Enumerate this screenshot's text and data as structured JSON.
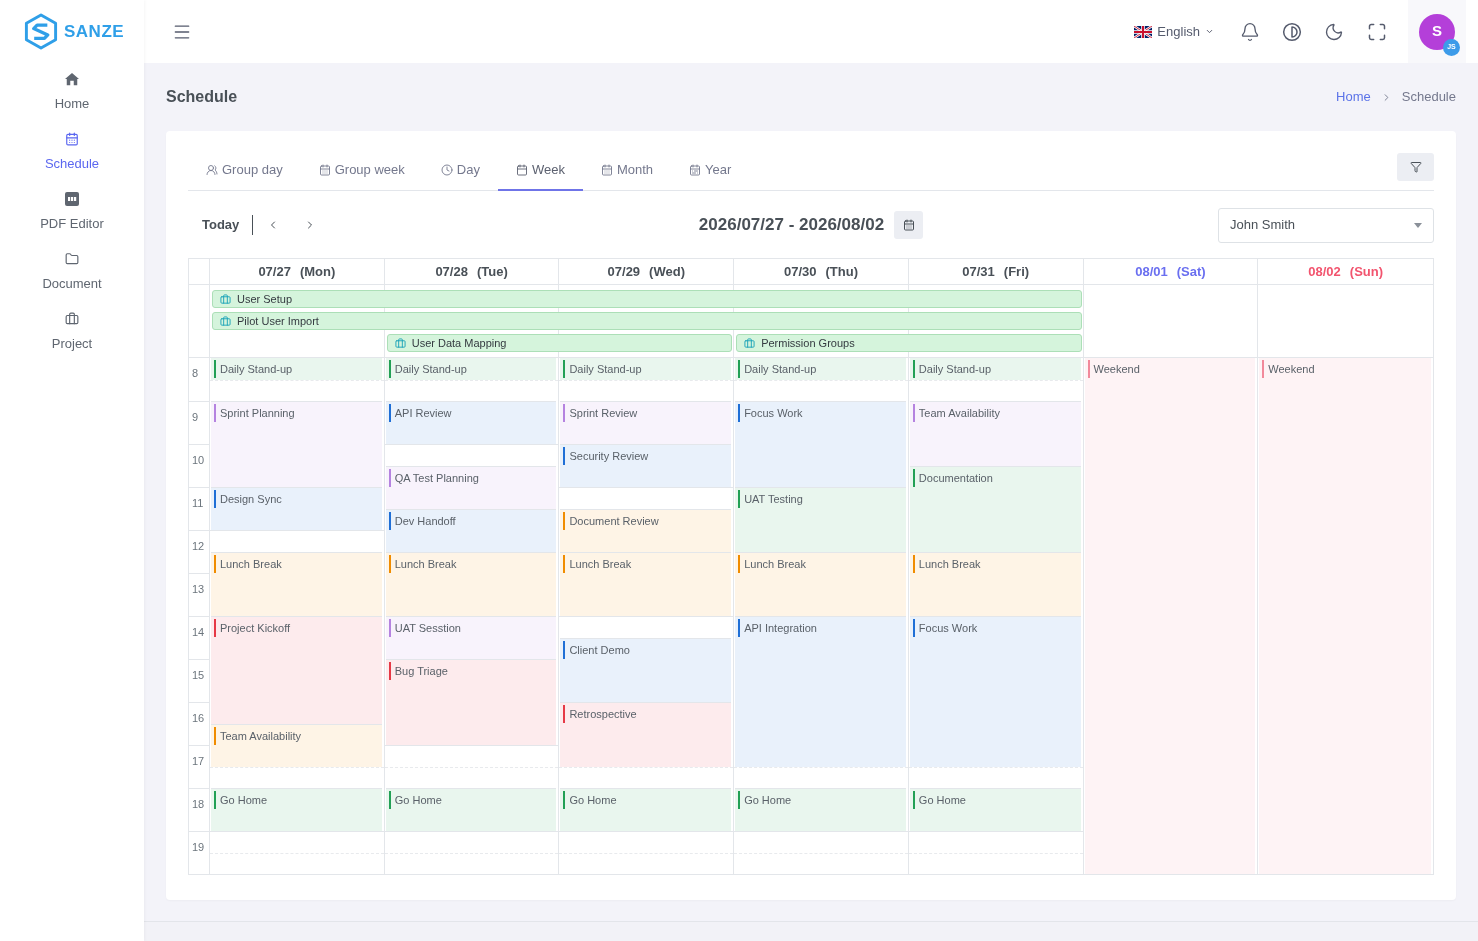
{
  "sidebar": {
    "logo_text": "SANZE",
    "items": [
      {
        "label": "Home",
        "selected": false
      },
      {
        "label": "Schedule",
        "selected": true
      },
      {
        "label": "PDF Editor",
        "selected": false
      },
      {
        "label": "Document",
        "selected": false
      },
      {
        "label": "Project",
        "selected": false
      }
    ]
  },
  "header": {
    "language": "English",
    "avatar": {
      "initial": "S",
      "badge": "JS"
    }
  },
  "page": {
    "title": "Schedule",
    "breadcrumb": [
      {
        "label": "Home",
        "kind": "link"
      },
      {
        "label": "Schedule",
        "kind": "current"
      }
    ]
  },
  "tabs": [
    {
      "label": "Group day",
      "selected": false
    },
    {
      "label": "Group week",
      "selected": false
    },
    {
      "label": "Day",
      "selected": false
    },
    {
      "label": "Week",
      "selected": true
    },
    {
      "label": "Month",
      "selected": false
    },
    {
      "label": "Year",
      "selected": false
    }
  ],
  "toolbar": {
    "today": "Today",
    "range": "2026/07/27 - 2026/08/02",
    "person": "John Smith"
  },
  "calendar": {
    "days": [
      {
        "date": "07/27",
        "weekday": "(Mon)",
        "kind": "weekday",
        "slots": [
          {
            "kind": "event",
            "title": "Daily Stand-up",
            "color": "#22a055"
          },
          {
            "kind": "free"
          },
          {
            "kind": "event",
            "title": "Sprint Planning",
            "color": "#b583e0"
          },
          {
            "kind": "continued"
          },
          {
            "kind": "continued"
          },
          {
            "kind": "continued"
          },
          {
            "kind": "event",
            "title": "Design Sync",
            "color": "#1f6fd6"
          },
          {
            "kind": "continued"
          },
          {
            "kind": "free"
          },
          {
            "kind": "event",
            "title": "Lunch Break",
            "color": "#f08c00"
          },
          {
            "kind": "continued"
          },
          {
            "kind": "continued"
          },
          {
            "kind": "event",
            "title": "Project Kickoff",
            "color": "#e63946"
          },
          {
            "kind": "continued"
          },
          {
            "kind": "continued"
          },
          {
            "kind": "continued"
          },
          {
            "kind": "continued"
          },
          {
            "kind": "event",
            "title": "Team Availability",
            "color": "#f08c00"
          },
          {
            "kind": "continued"
          },
          {
            "kind": "free"
          },
          {
            "kind": "event",
            "title": "Go Home",
            "color": "#22a055"
          },
          {
            "kind": "continued"
          },
          {
            "kind": "free"
          },
          {
            "kind": "free"
          }
        ]
      },
      {
        "date": "07/28",
        "weekday": "(Tue)",
        "kind": "weekday",
        "slots": [
          {
            "kind": "event",
            "title": "Daily Stand-up",
            "color": "#22a055"
          },
          {
            "kind": "free"
          },
          {
            "kind": "event",
            "title": "API Review",
            "color": "#1f6fd6"
          },
          {
            "kind": "continued"
          },
          {
            "kind": "free"
          },
          {
            "kind": "event",
            "title": "QA Test Planning",
            "color": "#b583e0"
          },
          {
            "kind": "continued"
          },
          {
            "kind": "event",
            "title": "Dev Handoff",
            "color": "#1f6fd6"
          },
          {
            "kind": "continued"
          },
          {
            "kind": "event",
            "title": "Lunch Break",
            "color": "#f08c00"
          },
          {
            "kind": "continued"
          },
          {
            "kind": "continued"
          },
          {
            "kind": "event",
            "title": "UAT Sesstion",
            "color": "#b583e0"
          },
          {
            "kind": "continued"
          },
          {
            "kind": "event",
            "title": "Bug Triage",
            "color": "#e63946"
          },
          {
            "kind": "continued"
          },
          {
            "kind": "continued"
          },
          {
            "kind": "continued"
          },
          {
            "kind": "free"
          },
          {
            "kind": "free"
          },
          {
            "kind": "event",
            "title": "Go Home",
            "color": "#22a055"
          },
          {
            "kind": "continued"
          },
          {
            "kind": "free"
          },
          {
            "kind": "free"
          }
        ]
      },
      {
        "date": "07/29",
        "weekday": "(Wed)",
        "kind": "weekday",
        "slots": [
          {
            "kind": "event",
            "title": "Daily Stand-up",
            "color": "#22a055"
          },
          {
            "kind": "free"
          },
          {
            "kind": "event",
            "title": "Sprint Review",
            "color": "#b583e0"
          },
          {
            "kind": "continued"
          },
          {
            "kind": "event",
            "title": "Security Review",
            "color": "#1f6fd6"
          },
          {
            "kind": "continued"
          },
          {
            "kind": "free"
          },
          {
            "kind": "event",
            "title": "Document Review",
            "color": "#f08c00"
          },
          {
            "kind": "continued"
          },
          {
            "kind": "event",
            "title": "Lunch Break",
            "color": "#f08c00"
          },
          {
            "kind": "continued"
          },
          {
            "kind": "continued"
          },
          {
            "kind": "free"
          },
          {
            "kind": "event",
            "title": "Client Demo",
            "color": "#1f6fd6"
          },
          {
            "kind": "continued"
          },
          {
            "kind": "continued"
          },
          {
            "kind": "event",
            "title": "Retrospective",
            "color": "#e63946"
          },
          {
            "kind": "continued"
          },
          {
            "kind": "continued"
          },
          {
            "kind": "free"
          },
          {
            "kind": "event",
            "title": "Go Home",
            "color": "#22a055"
          },
          {
            "kind": "continued"
          },
          {
            "kind": "free"
          },
          {
            "kind": "free"
          }
        ]
      },
      {
        "date": "07/30",
        "weekday": "(Thu)",
        "kind": "weekday",
        "slots": [
          {
            "kind": "event",
            "title": "Daily Stand-up",
            "color": "#22a055"
          },
          {
            "kind": "free"
          },
          {
            "kind": "event",
            "title": "Focus Work",
            "color": "#1f6fd6"
          },
          {
            "kind": "continued"
          },
          {
            "kind": "continued"
          },
          {
            "kind": "continued"
          },
          {
            "kind": "event",
            "title": "UAT Testing",
            "color": "#22a055"
          },
          {
            "kind": "continued"
          },
          {
            "kind": "continued"
          },
          {
            "kind": "event",
            "title": "Lunch Break",
            "color": "#f08c00"
          },
          {
            "kind": "continued"
          },
          {
            "kind": "continued"
          },
          {
            "kind": "event",
            "title": "API Integration",
            "color": "#1f6fd6"
          },
          {
            "kind": "continued"
          },
          {
            "kind": "continued"
          },
          {
            "kind": "continued"
          },
          {
            "kind": "continued"
          },
          {
            "kind": "continued"
          },
          {
            "kind": "continued"
          },
          {
            "kind": "free"
          },
          {
            "kind": "event",
            "title": "Go Home",
            "color": "#22a055"
          },
          {
            "kind": "continued"
          },
          {
            "kind": "free"
          },
          {
            "kind": "free"
          }
        ]
      },
      {
        "date": "07/31",
        "weekday": "(Fri)",
        "kind": "weekday",
        "slots": [
          {
            "kind": "event",
            "title": "Daily Stand-up",
            "color": "#22a055"
          },
          {
            "kind": "free"
          },
          {
            "kind": "event",
            "title": "Team Availability",
            "color": "#b583e0"
          },
          {
            "kind": "continued"
          },
          {
            "kind": "continued"
          },
          {
            "kind": "event",
            "title": "Documentation",
            "color": "#22a055"
          },
          {
            "kind": "continued"
          },
          {
            "kind": "continued"
          },
          {
            "kind": "continued"
          },
          {
            "kind": "event",
            "title": "Lunch Break",
            "color": "#f08c00"
          },
          {
            "kind": "continued"
          },
          {
            "kind": "continued"
          },
          {
            "kind": "event",
            "title": "Focus Work",
            "color": "#1f6fd6"
          },
          {
            "kind": "continued"
          },
          {
            "kind": "continued"
          },
          {
            "kind": "continued"
          },
          {
            "kind": "continued"
          },
          {
            "kind": "continued"
          },
          {
            "kind": "continued"
          },
          {
            "kind": "free"
          },
          {
            "kind": "event",
            "title": "Go Home",
            "color": "#22a055"
          },
          {
            "kind": "continued"
          },
          {
            "kind": "free"
          },
          {
            "kind": "free"
          }
        ]
      },
      {
        "date": "08/01",
        "weekday": "(Sat)",
        "kind": "saturday",
        "slots": [
          {
            "kind": "event",
            "title": "Weekend",
            "color": "#f2899b"
          },
          {
            "kind": "continued"
          },
          {
            "kind": "continued"
          },
          {
            "kind": "continued"
          },
          {
            "kind": "continued"
          },
          {
            "kind": "continued"
          },
          {
            "kind": "continued"
          },
          {
            "kind": "continued"
          },
          {
            "kind": "continued"
          },
          {
            "kind": "continued"
          },
          {
            "kind": "continued"
          },
          {
            "kind": "continued"
          },
          {
            "kind": "continued"
          },
          {
            "kind": "continued"
          },
          {
            "kind": "continued"
          },
          {
            "kind": "continued"
          },
          {
            "kind": "continued"
          },
          {
            "kind": "continued"
          },
          {
            "kind": "continued"
          },
          {
            "kind": "continued"
          },
          {
            "kind": "continued"
          },
          {
            "kind": "continued"
          },
          {
            "kind": "continued"
          },
          {
            "kind": "continued"
          }
        ]
      },
      {
        "date": "08/02",
        "weekday": "(Sun)",
        "kind": "sunday",
        "slots": [
          {
            "kind": "event",
            "title": "Weekend",
            "color": "#f2899b"
          },
          {
            "kind": "continued"
          },
          {
            "kind": "continued"
          },
          {
            "kind": "continued"
          },
          {
            "kind": "continued"
          },
          {
            "kind": "continued"
          },
          {
            "kind": "continued"
          },
          {
            "kind": "continued"
          },
          {
            "kind": "continued"
          },
          {
            "kind": "continued"
          },
          {
            "kind": "continued"
          },
          {
            "kind": "continued"
          },
          {
            "kind": "continued"
          },
          {
            "kind": "continued"
          },
          {
            "kind": "continued"
          },
          {
            "kind": "continued"
          },
          {
            "kind": "continued"
          },
          {
            "kind": "continued"
          },
          {
            "kind": "continued"
          },
          {
            "kind": "continued"
          },
          {
            "kind": "continued"
          },
          {
            "kind": "continued"
          },
          {
            "kind": "continued"
          },
          {
            "kind": "continued"
          }
        ]
      }
    ],
    "all_day_rows": [
      [
        {
          "kind": "event",
          "title": "User Setup"
        },
        {
          "kind": "continued"
        },
        {
          "kind": "continued"
        },
        {
          "kind": "continued"
        },
        {
          "kind": "continued"
        },
        {
          "kind": "free"
        },
        {
          "kind": "free"
        }
      ],
      [
        {
          "kind": "event",
          "title": "Pilot User Import"
        },
        {
          "kind": "continued"
        },
        {
          "kind": "continued"
        },
        {
          "kind": "continued"
        },
        {
          "kind": "continued"
        },
        {
          "kind": "free"
        },
        {
          "kind": "free"
        }
      ],
      [
        {
          "kind": "free"
        },
        {
          "kind": "event",
          "title": "User Data Mapping"
        },
        {
          "kind": "continued"
        },
        {
          "kind": "event",
          "title": "Permission Groups"
        },
        {
          "kind": "continued"
        },
        {
          "kind": "free"
        },
        {
          "kind": "free"
        }
      ]
    ],
    "hours": [
      "8",
      "9",
      "10",
      "11",
      "12",
      "13",
      "14",
      "15",
      "16",
      "17",
      "18",
      "19"
    ]
  }
}
